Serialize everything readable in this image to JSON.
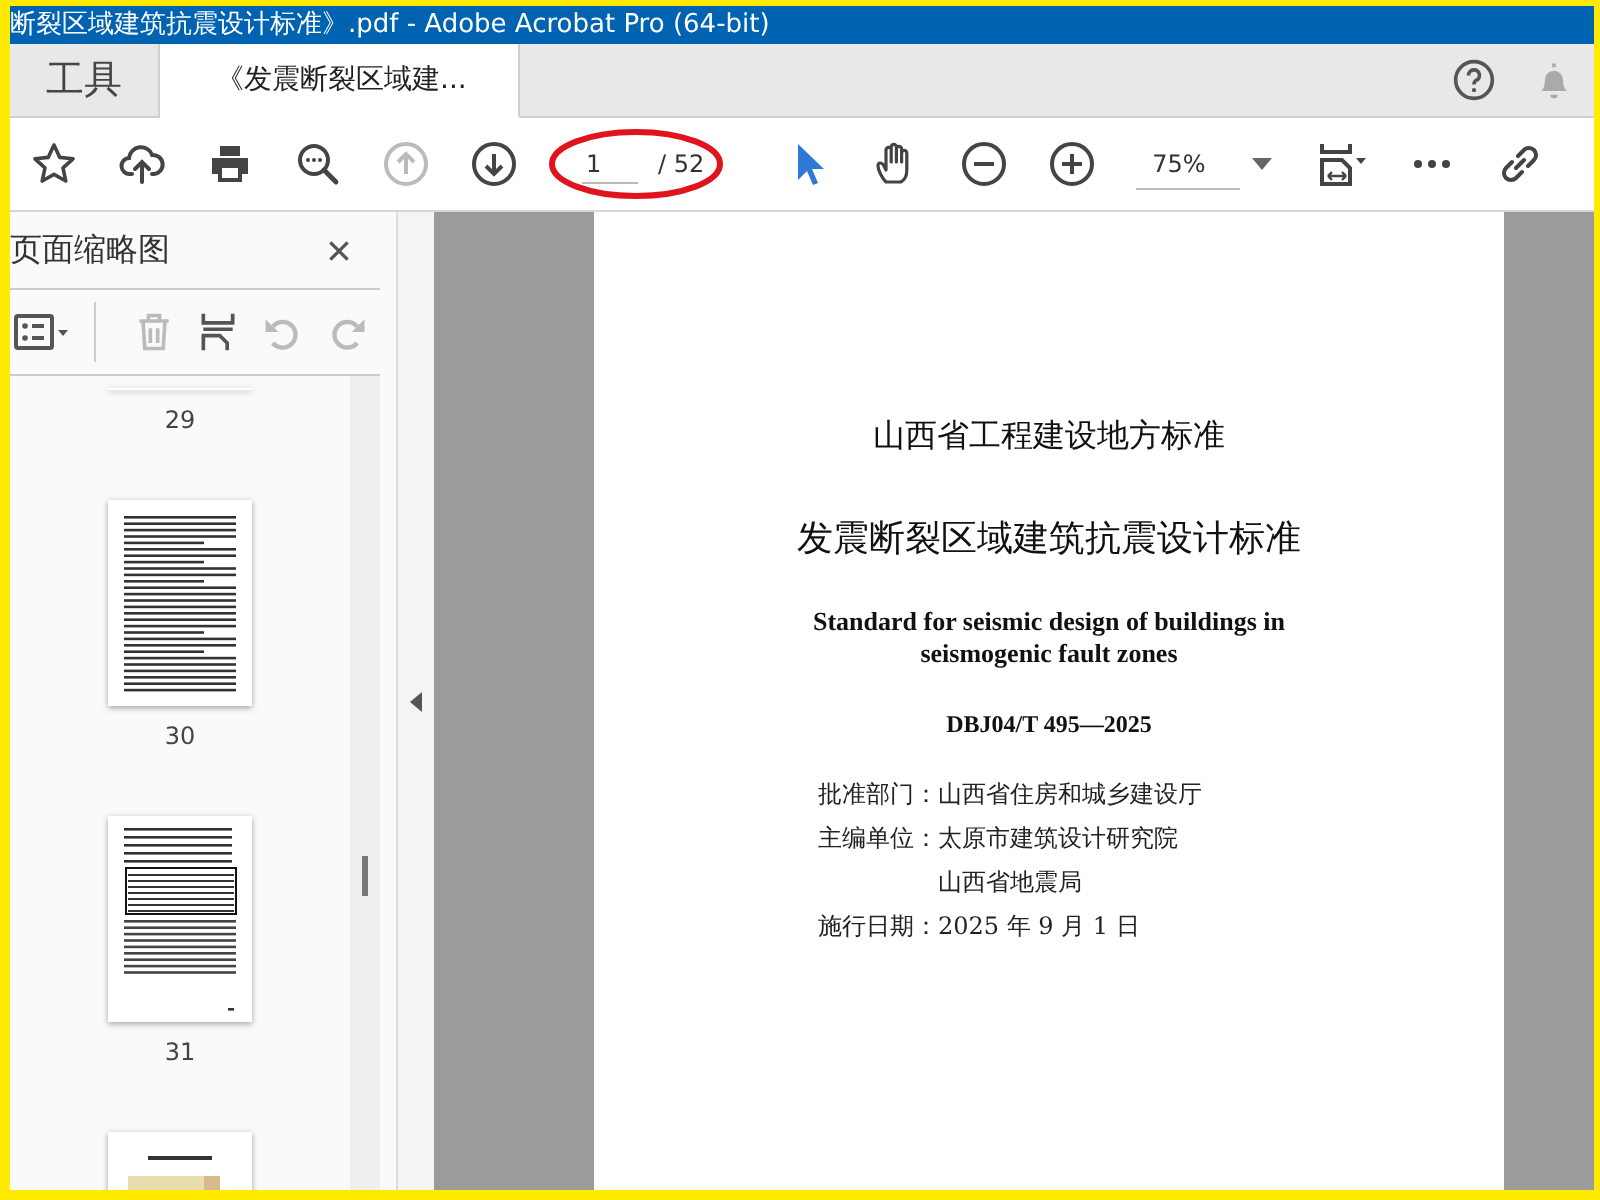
{
  "window": {
    "title": "断裂区域建筑抗震设计标准》.pdf - Adobe Acrobat Pro (64-bit)"
  },
  "tabs": [
    {
      "label": "工具",
      "selected": false
    },
    {
      "label": "《发震断裂区域建...",
      "selected": true
    }
  ],
  "header_tools": [
    {
      "kind": "help",
      "disabled": false
    },
    {
      "kind": "bell",
      "disabled": true
    }
  ],
  "toolbar": {
    "tools": [
      {
        "kind": "star",
        "disabled": false
      },
      {
        "kind": "upload",
        "disabled": false
      },
      {
        "kind": "print",
        "disabled": false
      },
      {
        "kind": "find",
        "disabled": false
      },
      {
        "kind": "prev",
        "disabled": true
      },
      {
        "kind": "next",
        "disabled": false
      },
      {
        "kind": "page",
        "value": "1",
        "total": "/ 52"
      },
      {
        "kind": "pointer",
        "selected": true
      },
      {
        "kind": "hand",
        "selected": false
      },
      {
        "kind": "zoomout",
        "disabled": false
      },
      {
        "kind": "zoomin",
        "disabled": false
      },
      {
        "kind": "zoom",
        "value": "75%"
      },
      {
        "kind": "fit",
        "disabled": false
      },
      {
        "kind": "more",
        "disabled": false
      },
      {
        "kind": "link",
        "disabled": false
      }
    ]
  },
  "sidebar": {
    "title": "页面缩略图",
    "tools": [
      {
        "kind": "options",
        "disabled": false
      },
      {
        "kind": "delete",
        "disabled": true
      },
      {
        "kind": "insert",
        "disabled": false
      },
      {
        "kind": "undo",
        "disabled": true
      },
      {
        "kind": "redo",
        "disabled": true
      }
    ],
    "thumbnails": [
      {
        "kind": "cut",
        "label": "29"
      },
      {
        "kind": "text",
        "label": "30"
      },
      {
        "kind": "table",
        "label": "31"
      },
      {
        "kind": "map"
      }
    ]
  },
  "document": {
    "lines": [
      {
        "kind": "subtitle",
        "text": "山西省工程建设地方标准"
      },
      {
        "kind": "title",
        "text": "发震断裂区域建筑抗震设计标准"
      },
      {
        "kind": "english",
        "text": "Standard for seismic design of buildings in seismogenic fault zones"
      },
      {
        "kind": "code",
        "text": "DBJ04/T 495—2025"
      },
      {
        "kind": "field",
        "label": "批准部门：",
        "values": [
          "山西省住房和城乡建设厅"
        ]
      },
      {
        "kind": "field",
        "label": "主编单位：",
        "values": [
          "太原市建筑设计研究院",
          "山西省地震局"
        ]
      },
      {
        "kind": "field",
        "label": "施行日期：",
        "values": [
          "2025 年 9 月 1 日"
        ]
      }
    ]
  }
}
